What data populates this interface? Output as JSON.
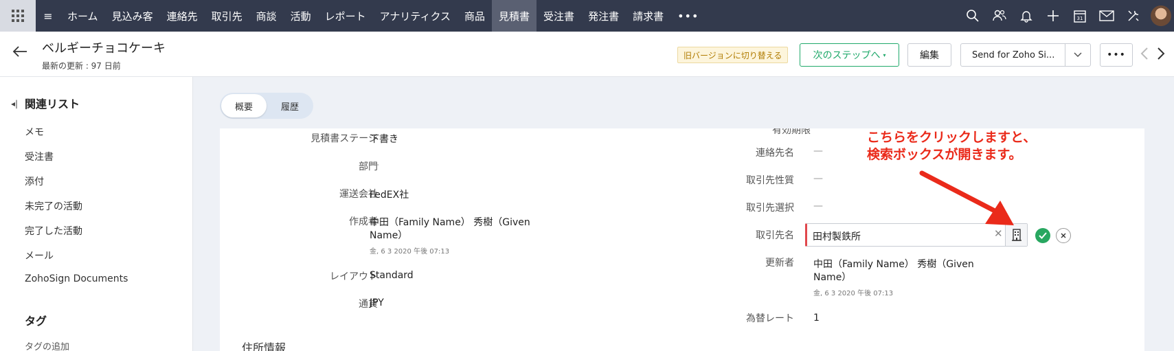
{
  "topnav": {
    "items": [
      "ホーム",
      "見込み客",
      "連絡先",
      "取引先",
      "商談",
      "活動",
      "レポート",
      "アナリティクス",
      "商品",
      "見積書",
      "受注書",
      "発注書",
      "請求書"
    ],
    "more": "•••",
    "active": "見積書",
    "icons": [
      "search-icon",
      "contacts-icon",
      "bell-icon",
      "plus-icon",
      "calendar-icon",
      "mail-icon",
      "settings-icon",
      "avatar"
    ]
  },
  "header": {
    "title": "ベルギーチョコケーキ",
    "subtitle": "最新の更新 : 97 日前",
    "old_version": "旧バージョンに切り替える",
    "next_step": "次のステップへ",
    "edit": "編集",
    "send": "Send for Zoho Si...",
    "more": "•••"
  },
  "sidebar": {
    "heading": "関連リスト",
    "items": [
      "メモ",
      "受注書",
      "添付",
      "未完了の活動",
      "完了した活動",
      "メール",
      "ZohoSign Documents"
    ],
    "tag_heading": "タグ",
    "tag_add": "タグの追加"
  },
  "tabs": {
    "summary": "概要",
    "history": "履歴"
  },
  "fields_left": {
    "stage": {
      "label": "見積書ステージ",
      "value": "下書き"
    },
    "dept": {
      "label": "部門",
      "value": "—"
    },
    "carrier": {
      "label": "運送会社",
      "value": "FedEX社"
    },
    "creator": {
      "label": "作成者",
      "value_line1": "中田（Family Name） 秀樹（Given",
      "value_line2": "Name）",
      "date": "金, 6 3 2020 午後 07:13"
    },
    "layout": {
      "label": "レイアウト",
      "value": "Standard"
    },
    "currency": {
      "label": "通貨",
      "value": "JPY"
    }
  },
  "fields_right": {
    "clipped_label": "有効期限",
    "contact": {
      "label": "連絡先名",
      "value": "—"
    },
    "account_type": {
      "label": "取引先性質",
      "value": "—"
    },
    "account_select": {
      "label": "取引先選択",
      "value": "—"
    },
    "account_name": {
      "label": "取引先名",
      "value": "田村製鉄所"
    },
    "modifier": {
      "label": "更新者",
      "value_line1": "中田（Family Name） 秀樹（Given",
      "value_line2": "Name）",
      "date": "金, 6 3 2020 午後 07:13"
    },
    "exchange": {
      "label": "為替レート",
      "value": "1"
    }
  },
  "section": {
    "address": "住所情報"
  },
  "annotation": {
    "line1": "こちらをクリックしますと、",
    "line2": "検索ボックスが開きます。",
    "color": "#ea2a1a"
  }
}
